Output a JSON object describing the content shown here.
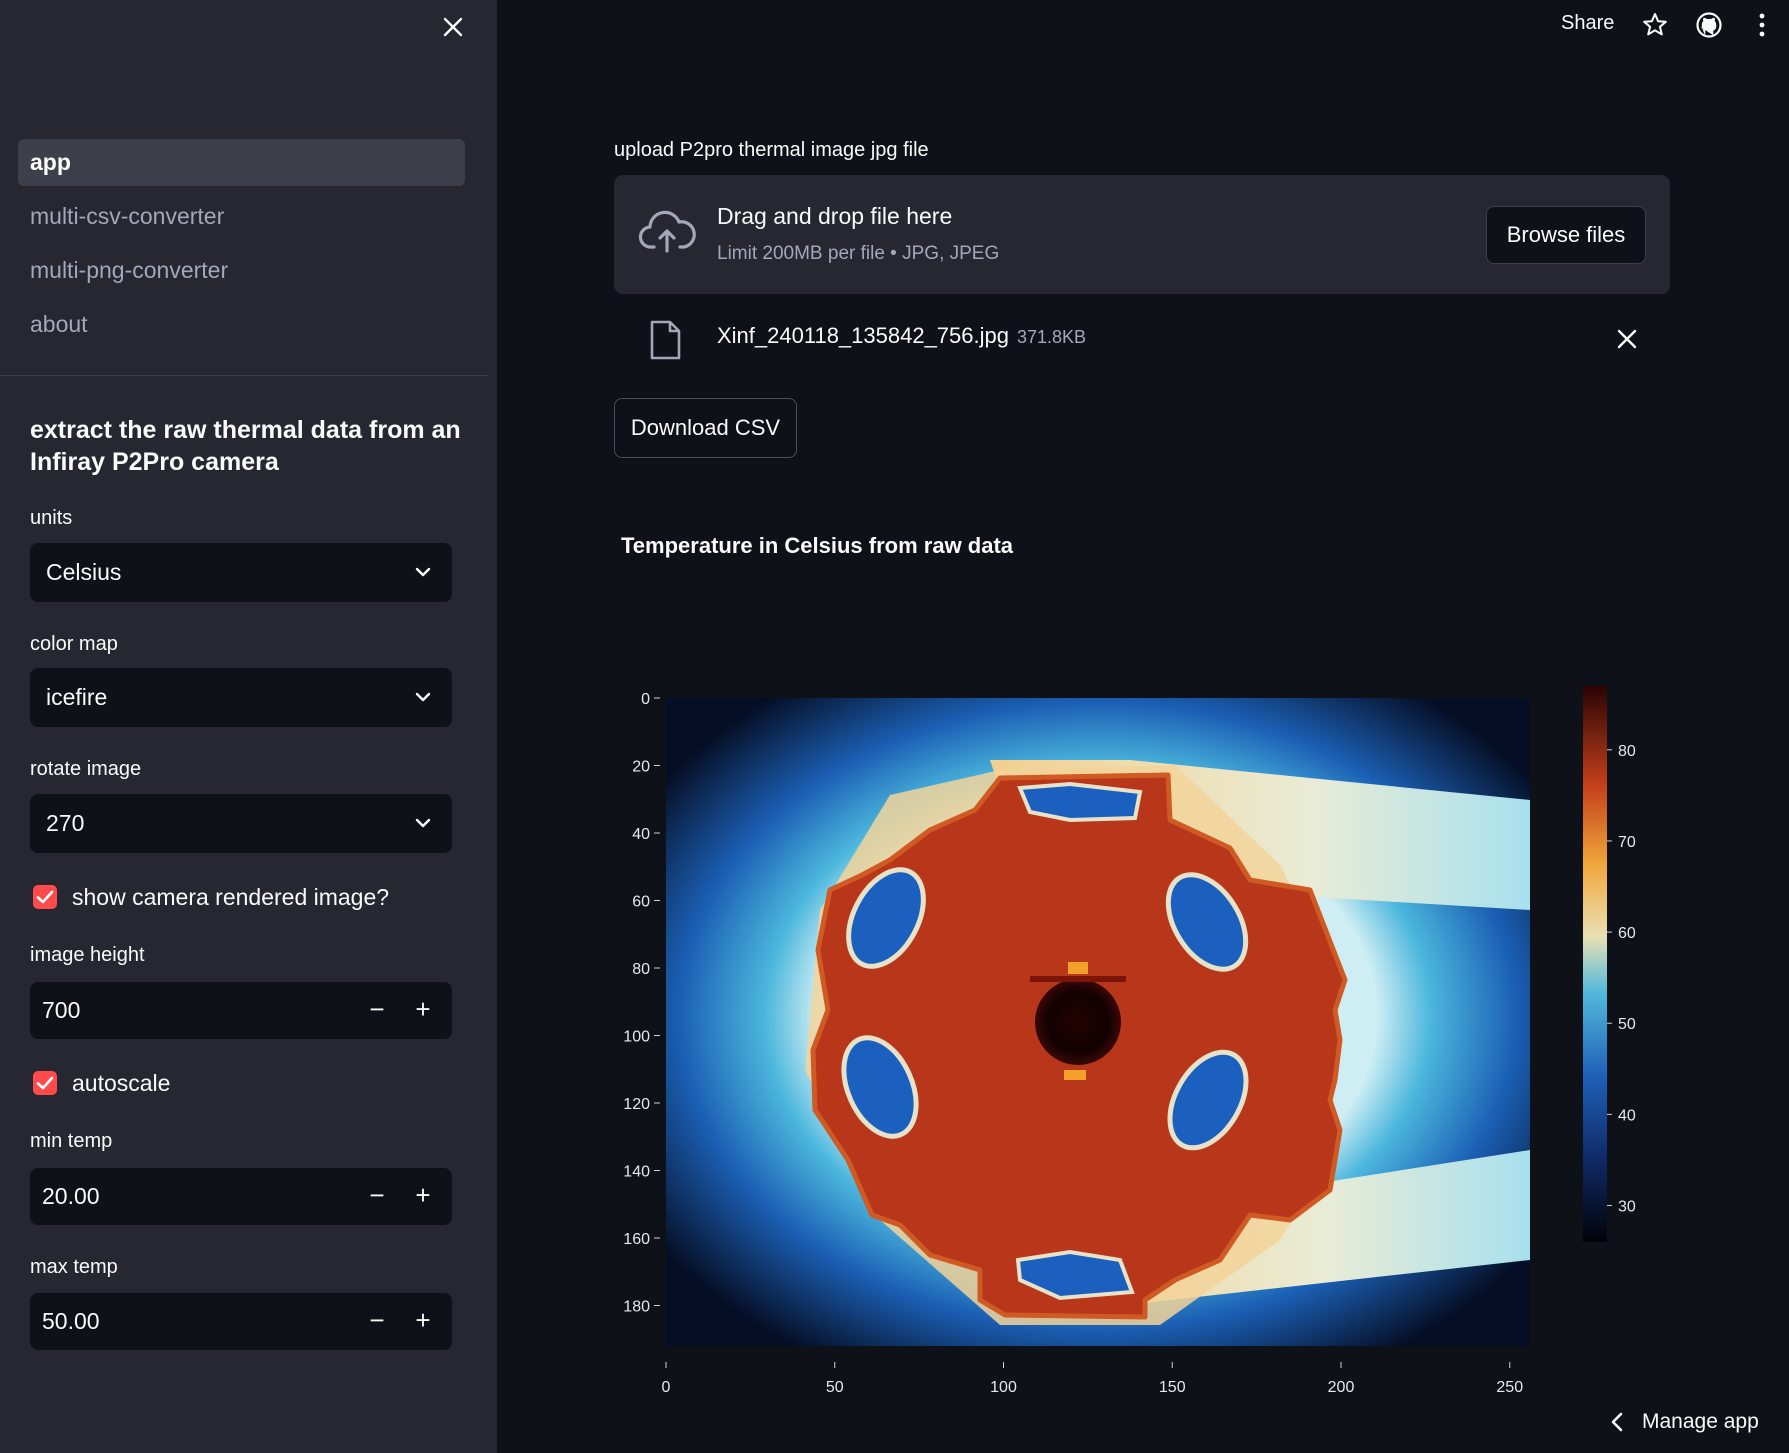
{
  "sidebar": {
    "nav": [
      {
        "label": "app",
        "active": true
      },
      {
        "label": "multi-csv-converter",
        "active": false
      },
      {
        "label": "multi-png-converter",
        "active": false
      },
      {
        "label": "about",
        "active": false
      }
    ],
    "heading": "extract the raw thermal data from an Infiray P2Pro camera",
    "units": {
      "label": "units",
      "value": "Celsius"
    },
    "color_map": {
      "label": "color map",
      "value": "icefire"
    },
    "rotate": {
      "label": "rotate image",
      "value": "270"
    },
    "show_rendered": {
      "label": "show camera rendered image?",
      "checked": true
    },
    "image_height": {
      "label": "image height",
      "value": "700"
    },
    "autoscale": {
      "label": "autoscale",
      "checked": true
    },
    "min_temp": {
      "label": "min temp",
      "value": "20.00"
    },
    "max_temp": {
      "label": "max temp",
      "value": "50.00"
    },
    "minus": "−",
    "plus": "+"
  },
  "header": {
    "share": "Share",
    "icons": [
      "star-icon",
      "github-icon",
      "more-vertical-icon"
    ]
  },
  "uploader": {
    "label": "upload P2pro thermal image jpg file",
    "title": "Drag and drop file here",
    "subtitle": "Limit 200MB per file • JPG, JPEG",
    "browse": "Browse files",
    "file_name": "Xinf_240118_135842_756.jpg",
    "file_size": "371.8KB"
  },
  "download_label": "Download CSV",
  "manage_label": "Manage app",
  "colors": {
    "accent": "#ff4b4b",
    "sidebar_bg": "#262730",
    "app_bg": "#0e1117"
  },
  "chart_data": {
    "type": "heatmap",
    "title": "Temperature in Celsius from raw data",
    "x_ticks": [
      0,
      50,
      100,
      150,
      200,
      250
    ],
    "y_ticks": [
      0,
      20,
      40,
      60,
      80,
      100,
      120,
      140,
      160,
      180
    ],
    "xlim": [
      0,
      256
    ],
    "ylim": [
      0,
      192
    ],
    "colorbar": {
      "colormap": "icefire",
      "ticks": [
        30,
        40,
        50,
        60,
        70,
        80
      ],
      "range": [
        26,
        87
      ]
    }
  }
}
